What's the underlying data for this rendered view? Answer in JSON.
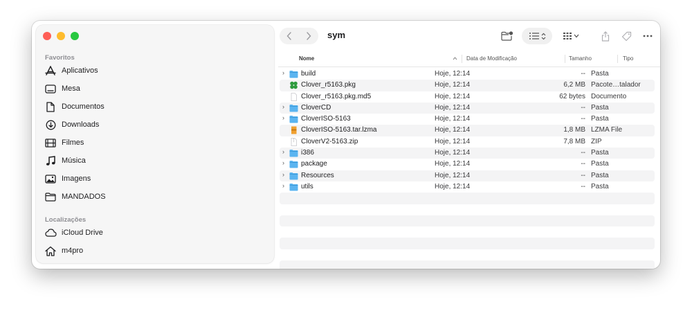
{
  "window": {
    "title": "sym"
  },
  "sidebar": {
    "favorites_label": "Favoritos",
    "favorites": [
      {
        "label": "Aplicativos",
        "icon": "applications-icon"
      },
      {
        "label": "Mesa",
        "icon": "desktop-icon"
      },
      {
        "label": "Documentos",
        "icon": "document-icon"
      },
      {
        "label": "Downloads",
        "icon": "downloads-icon"
      },
      {
        "label": "Filmes",
        "icon": "film-icon"
      },
      {
        "label": "Música",
        "icon": "music-icon"
      },
      {
        "label": "Imagens",
        "icon": "photo-icon"
      },
      {
        "label": "MANDADOS",
        "icon": "folder-icon"
      }
    ],
    "locations_label": "Localizações",
    "locations": [
      {
        "label": "iCloud Drive",
        "icon": "cloud-icon"
      },
      {
        "label": "m4pro",
        "icon": "home-icon"
      }
    ]
  },
  "columns": {
    "name": "Nome",
    "date": "Data de Modificação",
    "size": "Tamanho",
    "kind": "Tipo"
  },
  "files": [
    {
      "name": "build",
      "date": "Hoje, 12:14",
      "size": "--",
      "kind": "Pasta",
      "icon": "folder-icon"
    },
    {
      "name": "Clover_r5163.pkg",
      "date": "Hoje, 12:14",
      "size": "6,2 MB",
      "kind": "Pacote…talador",
      "icon": "package-icon"
    },
    {
      "name": "Clover_r5163.pkg.md5",
      "date": "Hoje, 12:14",
      "size": "62 bytes",
      "kind": "Documento",
      "icon": "document-icon"
    },
    {
      "name": "CloverCD",
      "date": "Hoje, 12:14",
      "size": "--",
      "kind": "Pasta",
      "icon": "folder-icon"
    },
    {
      "name": "CloverISO-5163",
      "date": "Hoje, 12:14",
      "size": "--",
      "kind": "Pasta",
      "icon": "folder-icon"
    },
    {
      "name": "CloverISO-5163.tar.lzma",
      "date": "Hoje, 12:14",
      "size": "1,8 MB",
      "kind": "LZMA File",
      "icon": "archive-icon"
    },
    {
      "name": "CloverV2-5163.zip",
      "date": "Hoje, 12:14",
      "size": "7,8 MB",
      "kind": "ZIP",
      "icon": "zip-icon"
    },
    {
      "name": "i386",
      "date": "Hoje, 12:14",
      "size": "--",
      "kind": "Pasta",
      "icon": "folder-icon"
    },
    {
      "name": "package",
      "date": "Hoje, 12:14",
      "size": "--",
      "kind": "Pasta",
      "icon": "folder-icon"
    },
    {
      "name": "Resources",
      "date": "Hoje, 12:14",
      "size": "--",
      "kind": "Pasta",
      "icon": "folder-icon"
    },
    {
      "name": "utils",
      "date": "Hoje, 12:14",
      "size": "--",
      "kind": "Pasta",
      "icon": "folder-icon"
    }
  ],
  "colors": {
    "folder": "#5ab4f0",
    "close": "#ff5f57",
    "minimize": "#febc2e",
    "maximize": "#28c840"
  }
}
